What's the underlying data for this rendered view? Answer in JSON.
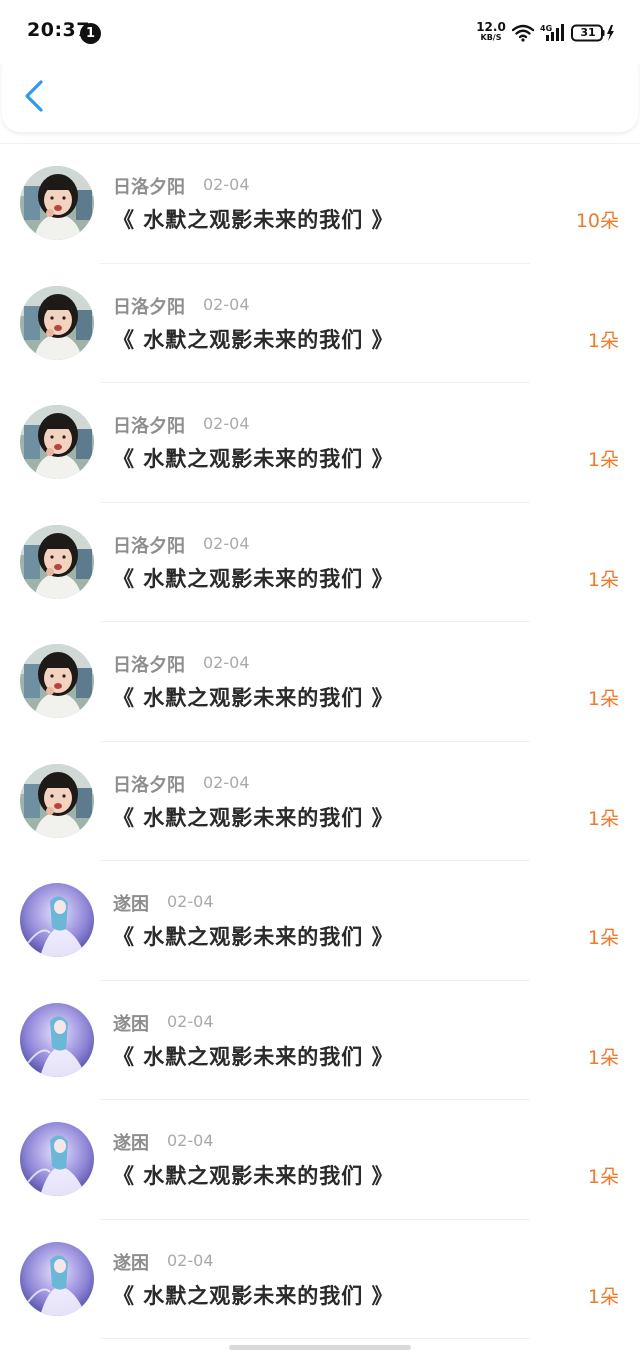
{
  "status_bar": {
    "time": "20:37",
    "notification_count": "1",
    "net_speed_value": "12.0",
    "net_speed_unit": "KB/S",
    "battery_level": "31"
  },
  "nav": {
    "back_icon": "chevron-left-icon",
    "accent_color": "#2b9af3"
  },
  "items": [
    {
      "user": "日洛夕阳",
      "date": "02-04",
      "title": "《 水默之观影未来的我们 》",
      "count": "10朵",
      "avatar": "girl-photo"
    },
    {
      "user": "日洛夕阳",
      "date": "02-04",
      "title": "《 水默之观影未来的我们 》",
      "count": "1朵",
      "avatar": "girl-photo"
    },
    {
      "user": "日洛夕阳",
      "date": "02-04",
      "title": "《 水默之观影未来的我们 》",
      "count": "1朵",
      "avatar": "girl-photo"
    },
    {
      "user": "日洛夕阳",
      "date": "02-04",
      "title": "《 水默之观影未来的我们 》",
      "count": "1朵",
      "avatar": "girl-photo"
    },
    {
      "user": "日洛夕阳",
      "date": "02-04",
      "title": "《 水默之观影未来的我们 》",
      "count": "1朵",
      "avatar": "girl-photo"
    },
    {
      "user": "日洛夕阳",
      "date": "02-04",
      "title": "《 水默之观影未来的我们 》",
      "count": "1朵",
      "avatar": "girl-photo"
    },
    {
      "user": "遂困",
      "date": "02-04",
      "title": "《 水默之观影未来的我们 》",
      "count": "1朵",
      "avatar": "anime-photo"
    },
    {
      "user": "遂困",
      "date": "02-04",
      "title": "《 水默之观影未来的我们 》",
      "count": "1朵",
      "avatar": "anime-photo"
    },
    {
      "user": "遂困",
      "date": "02-04",
      "title": "《 水默之观影未来的我们 》",
      "count": "1朵",
      "avatar": "anime-photo"
    },
    {
      "user": "遂困",
      "date": "02-04",
      "title": "《 水默之观影未来的我们 》",
      "count": "1朵",
      "avatar": "anime-photo"
    }
  ],
  "colors": {
    "count_color": "#f07a2c",
    "name_color": "#8e8e8e",
    "date_color": "#aaaaaa",
    "title_color": "#2a2a2a"
  }
}
